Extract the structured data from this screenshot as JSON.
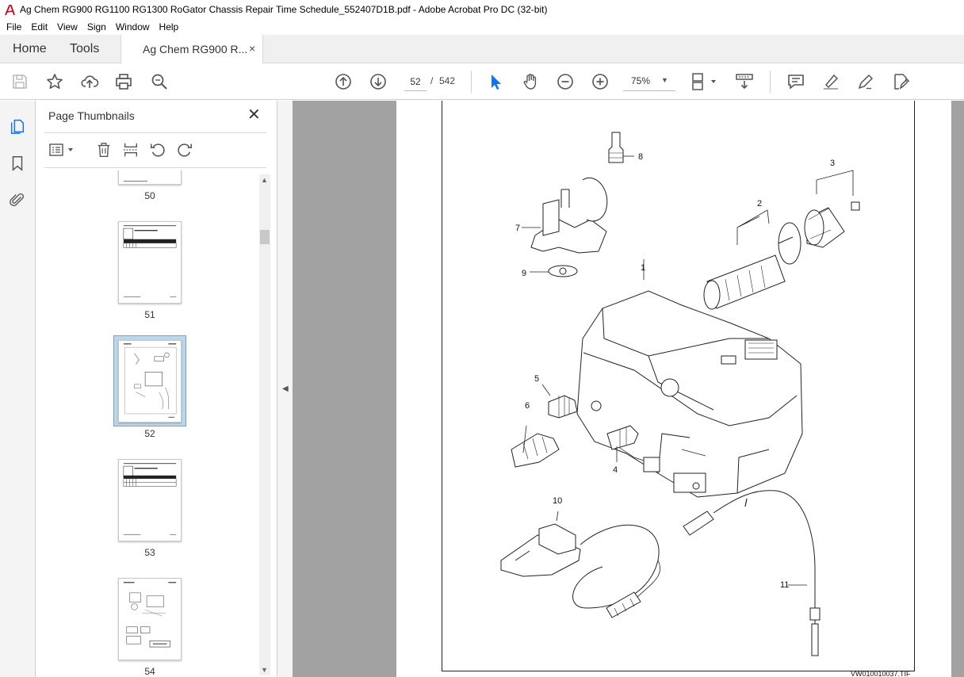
{
  "window": {
    "title": "Ag Chem RG900 RG1100 RG1300 RoGator Chassis Repair Time Schedule_552407D1B.pdf - Adobe Acrobat Pro DC (32-bit)"
  },
  "menu": [
    "File",
    "Edit",
    "View",
    "Sign",
    "Window",
    "Help"
  ],
  "tabs": {
    "home": "Home",
    "tools": "Tools",
    "document": "Ag Chem RG900 R...",
    "close_glyph": "×"
  },
  "toolbar": {
    "current_page": "52",
    "separator": "/",
    "total_pages": "542",
    "zoom": "75%",
    "accent_color": "#1473e6"
  },
  "panel": {
    "title": "Page Thumbnails",
    "close_glyph": "✕",
    "thumbnails": [
      {
        "number": "50"
      },
      {
        "number": "51"
      },
      {
        "number": "52",
        "selected": true
      },
      {
        "number": "53"
      },
      {
        "number": "54"
      }
    ]
  },
  "document": {
    "callouts": [
      "1",
      "2",
      "3",
      "4",
      "5",
      "6",
      "7",
      "8",
      "9",
      "10",
      "11"
    ],
    "figure_code": "VW010010037.TIF"
  }
}
